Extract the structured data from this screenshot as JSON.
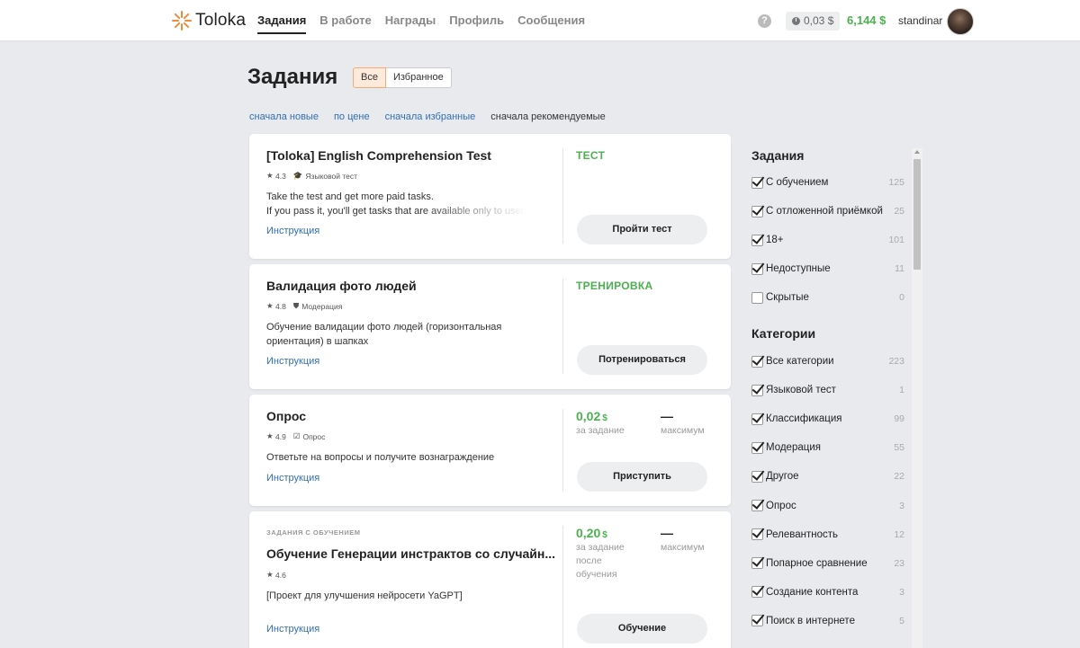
{
  "header": {
    "brand": "Toloka",
    "nav": [
      {
        "label": "Задания",
        "active": true
      },
      {
        "label": "В работе",
        "active": false
      },
      {
        "label": "Награды",
        "active": false
      },
      {
        "label": "Профиль",
        "active": false
      },
      {
        "label": "Сообщения",
        "active": false
      }
    ],
    "help": "?",
    "pending": "0,03 $",
    "balance": "6,144 $",
    "username": "standinar"
  },
  "page": {
    "title": "Задания",
    "filters": {
      "all": "Все",
      "favorites": "Избранное"
    },
    "sorts": [
      "сначала новые",
      "по цене",
      "сначала избранные",
      "сначала рекомендуемые"
    ],
    "current_sort": "сначала рекомендуемые"
  },
  "cards": [
    {
      "title": "[Toloka] English Comprehension Test",
      "rating": "4.3",
      "category": "Языковой тест",
      "desc1": "Take the test and get more paid tasks.",
      "desc2": "If you pass it, you'll get tasks that are available only to users",
      "link": "Инструкция",
      "tag": "ТЕСТ",
      "button": "Пройти тест"
    },
    {
      "title": "Валидация фото людей",
      "rating": "4.8",
      "category": "Модерация",
      "desc1": "Обучение валидации фото людей (горизонтальная ориентация) в шапках",
      "link": "Инструкция",
      "tag": "ТРЕНИРОВКА",
      "button": "Потренироваться"
    },
    {
      "title": "Опрос",
      "rating": "4.9",
      "category": "Опрос",
      "desc1": "Ответьте на вопросы и получите вознаграждение",
      "link": "Инструкция",
      "price": "0,02",
      "currency": "$",
      "price_label": "за задание",
      "max": "—",
      "max_label": "максимум",
      "button": "Приступить"
    },
    {
      "overline": "ЗАДАНИЯ С ОБУЧЕНИЕМ",
      "title": "Обучение Генерации инстрактов со случайн...",
      "rating": "4.6",
      "desc1": "[Проект для улучшения нейросети YaGPT]",
      "link": "Инструкция",
      "price": "0,20",
      "currency": "$",
      "price_label": "за задание после обучения",
      "max": "—",
      "max_label": "максимум",
      "button": "Обучение"
    }
  ],
  "sidebar": {
    "tasks_title": "Задания",
    "tasks": [
      {
        "label": "С обучением",
        "count": "125",
        "checked": true
      },
      {
        "label": "С отложенной приёмкой",
        "count": "25",
        "checked": true
      },
      {
        "label": "18+",
        "count": "101",
        "checked": true
      },
      {
        "label": "Недоступные",
        "count": "11",
        "checked": true
      },
      {
        "label": "Скрытые",
        "count": "0",
        "checked": false
      }
    ],
    "categories_title": "Категории",
    "categories": [
      {
        "label": "Все категории",
        "count": "223",
        "checked": true
      },
      {
        "label": "Языковой тест",
        "count": "1",
        "checked": true
      },
      {
        "label": "Классификация",
        "count": "99",
        "checked": true
      },
      {
        "label": "Модерация",
        "count": "55",
        "checked": true
      },
      {
        "label": "Другое",
        "count": "22",
        "checked": true
      },
      {
        "label": "Опрос",
        "count": "3",
        "checked": true
      },
      {
        "label": "Релевантность",
        "count": "12",
        "checked": true
      },
      {
        "label": "Попарное сравнение",
        "count": "23",
        "checked": true
      },
      {
        "label": "Создание контента",
        "count": "3",
        "checked": true
      },
      {
        "label": "Поиск в интернете",
        "count": "5",
        "checked": true
      }
    ]
  },
  "colors": {
    "accent": "#4caf50",
    "link": "#2f6fb3",
    "brand": "#f08a3c"
  }
}
